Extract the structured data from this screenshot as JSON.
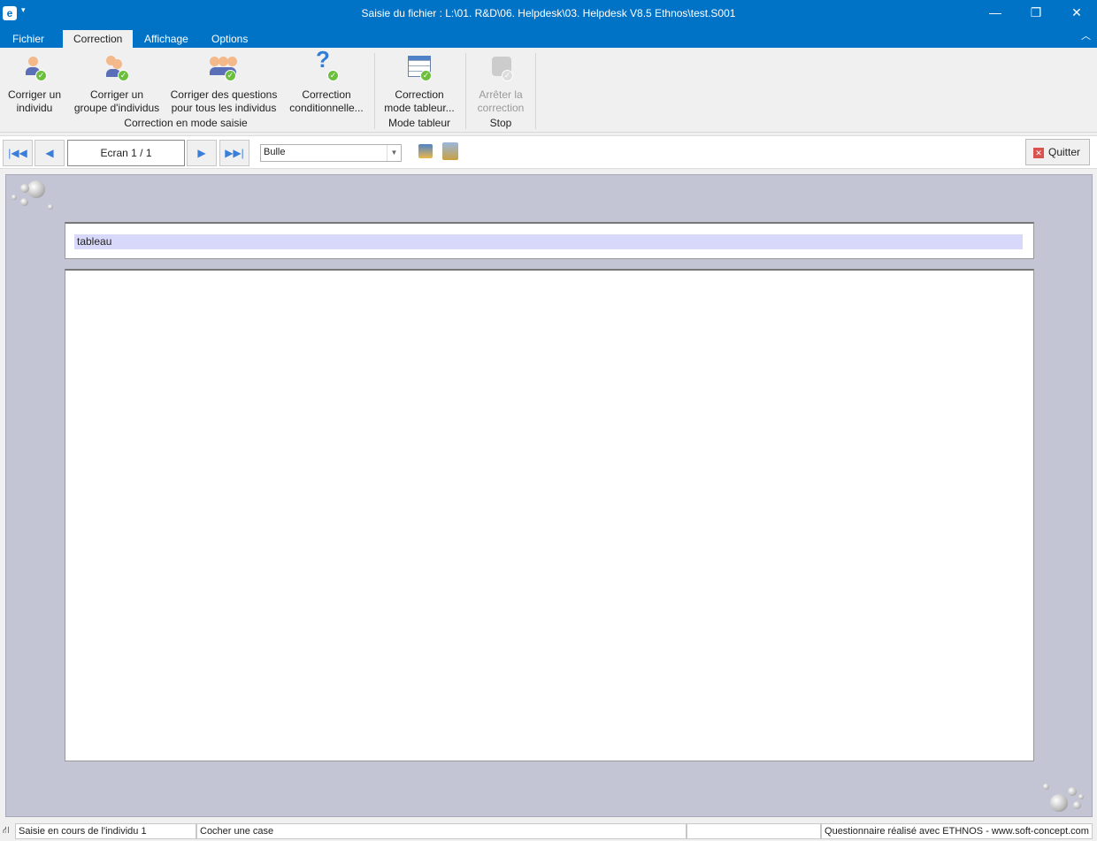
{
  "window": {
    "title": "Saisie du fichier : L:\\01. R&D\\06. Helpdesk\\03. Helpdesk V8.5 Ethnos\\test.S001",
    "accent": "#0173c7"
  },
  "tabs": [
    {
      "label": "Fichier"
    },
    {
      "label": "Correction",
      "active": true
    },
    {
      "label": "Affichage"
    },
    {
      "label": "Options"
    }
  ],
  "ribbon": {
    "buttons": [
      {
        "line1": "Corriger un",
        "line2": "individu"
      },
      {
        "line1": "Corriger un",
        "line2": "groupe d'individus"
      },
      {
        "line1": "Corriger des questions",
        "line2": "pour tous les individus"
      },
      {
        "line1": "Correction",
        "line2": "conditionnelle..."
      },
      {
        "line1": "Correction",
        "line2": "mode tableur..."
      },
      {
        "line1": "Arrêter la",
        "line2": "correction",
        "disabled": true
      }
    ],
    "groups": [
      "Correction en mode saisie",
      "Mode tableur",
      "Stop"
    ]
  },
  "toolbar": {
    "screen": "Ecran 1 / 1",
    "combo_value": "Bulle",
    "quit_label": "Quitter"
  },
  "question": {
    "label": "tableau"
  },
  "status": {
    "cells": [
      "Saisie en cours de l'individu 1",
      "Cocher une case",
      "",
      "Questionnaire réalisé avec ETHNOS - www.soft-concept.com"
    ]
  }
}
